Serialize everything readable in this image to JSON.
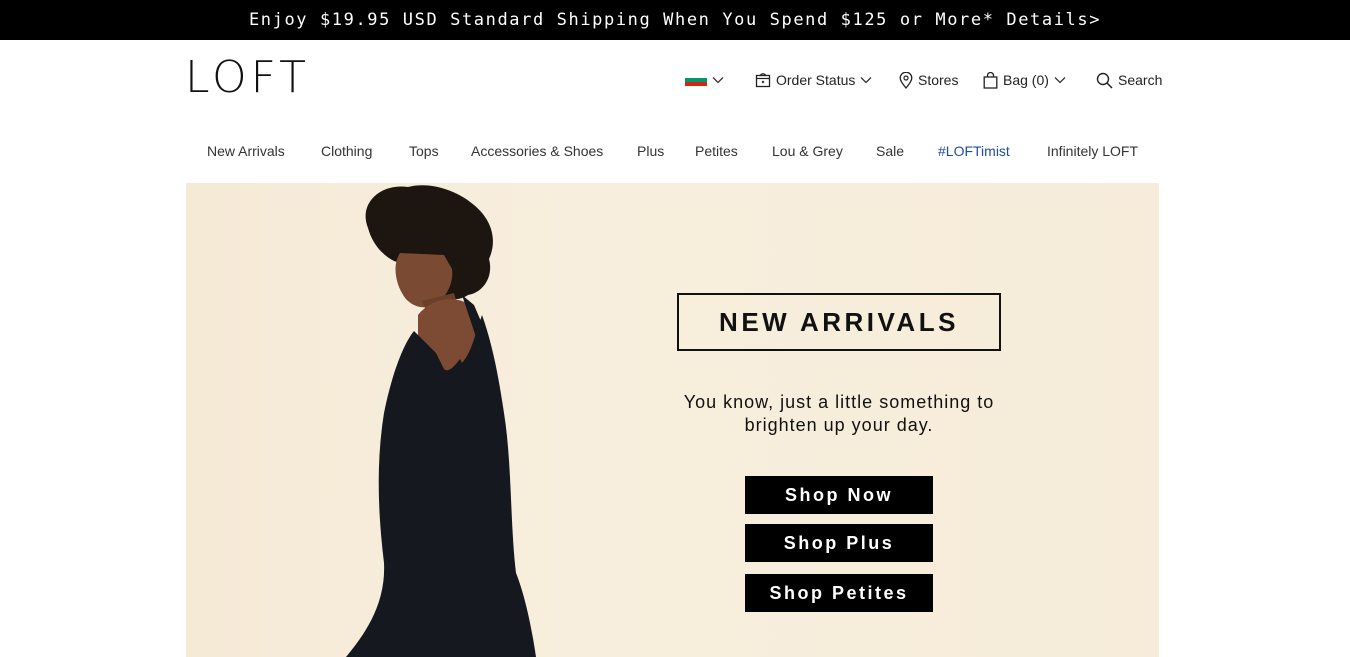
{
  "promo": {
    "text": "Enjoy $19.95 USD Standard Shipping When You Spend $125 or More* Details>"
  },
  "header": {
    "logo": "LOFT",
    "order_status": "Order Status",
    "stores": "Stores",
    "bag": "Bag (0)",
    "search": "Search"
  },
  "nav": {
    "items": [
      {
        "label": "New Arrivals"
      },
      {
        "label": "Clothing"
      },
      {
        "label": "Tops"
      },
      {
        "label": "Accessories & Shoes"
      },
      {
        "label": "Plus"
      },
      {
        "label": "Petites"
      },
      {
        "label": "Lou & Grey"
      },
      {
        "label": "Sale"
      },
      {
        "label": "#LOFTimist",
        "color": "#1e4fa3"
      },
      {
        "label": "Infinitely LOFT"
      }
    ]
  },
  "hero": {
    "title": "NEW ARRIVALS",
    "subtitle_line1": "You know, just a little something to",
    "subtitle_line2": "brighten up your day.",
    "buttons": [
      "Shop Now",
      "Shop Plus",
      "Shop Petites"
    ]
  },
  "colors": {
    "flag": [
      "#ffffff",
      "#00966e",
      "#d62612"
    ],
    "accent_link": "#1e4fa3",
    "hero_bg": "#f6ecd9"
  }
}
